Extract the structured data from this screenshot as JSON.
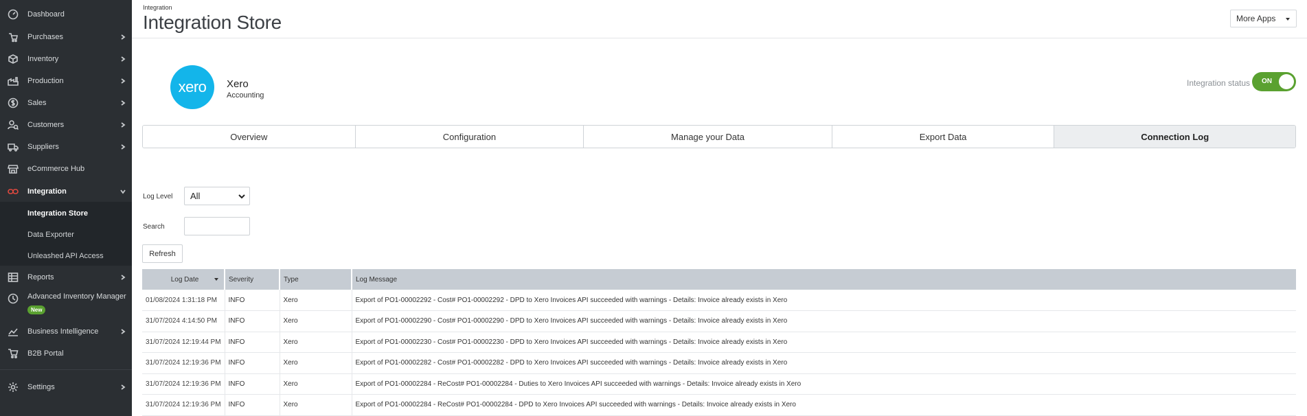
{
  "sidebar": {
    "items": [
      {
        "label": "Dashboard",
        "icon": "dashboard-icon",
        "has_children": false
      },
      {
        "label": "Purchases",
        "icon": "purchases-icon",
        "has_children": true
      },
      {
        "label": "Inventory",
        "icon": "inventory-icon",
        "has_children": true
      },
      {
        "label": "Production",
        "icon": "production-icon",
        "has_children": true
      },
      {
        "label": "Sales",
        "icon": "sales-icon",
        "has_children": true
      },
      {
        "label": "Customers",
        "icon": "customers-icon",
        "has_children": true
      },
      {
        "label": "Suppliers",
        "icon": "suppliers-icon",
        "has_children": true
      },
      {
        "label": "eCommerce Hub",
        "icon": "ecommerce-icon",
        "has_children": false
      },
      {
        "label": "Integration",
        "icon": "integration-icon",
        "has_children": true,
        "expanded": true
      },
      {
        "label": "Reports",
        "icon": "reports-icon",
        "has_children": true
      },
      {
        "label": "Advanced Inventory Manager",
        "icon": "advanced-inventory-icon",
        "has_children": false,
        "badge": "New"
      },
      {
        "label": "Business Intelligence",
        "icon": "business-intelligence-icon",
        "has_children": true
      },
      {
        "label": "B2B Portal",
        "icon": "b2b-portal-icon",
        "has_children": false
      },
      {
        "label": "Settings",
        "icon": "settings-icon",
        "has_children": true
      }
    ],
    "integration_submenu": [
      "Integration Store",
      "Data Exporter",
      "Unleashed API Access"
    ],
    "badge_new": "New"
  },
  "header": {
    "breadcrumb": "Integration",
    "title": "Integration Store",
    "more_apps": "More Apps"
  },
  "app": {
    "logo_text": "xero",
    "name": "Xero",
    "category": "Accounting",
    "status_label": "Integration status",
    "status_value": "ON"
  },
  "tabs": [
    "Overview",
    "Configuration",
    "Manage your Data",
    "Export Data",
    "Connection Log"
  ],
  "filters": {
    "log_level_label": "Log Level",
    "log_level_value": "All",
    "search_label": "Search",
    "search_value": "",
    "refresh_label": "Refresh"
  },
  "table": {
    "columns": [
      "Log Date",
      "Severity",
      "Type",
      "Log Message"
    ],
    "rows": [
      [
        "01/08/2024 1:31:18 PM",
        "INFO",
        "Xero",
        "Export of PO1-00002292 - Cost# PO1-00002292 - DPD to Xero Invoices API succeeded with warnings - Details: Invoice already exists in Xero"
      ],
      [
        "31/07/2024 4:14:50 PM",
        "INFO",
        "Xero",
        "Export of PO1-00002290 - Cost# PO1-00002290 - DPD to Xero Invoices API succeeded with warnings - Details: Invoice already exists in Xero"
      ],
      [
        "31/07/2024 12:19:44 PM",
        "INFO",
        "Xero",
        "Export of PO1-00002230 - Cost# PO1-00002230 - DPD to Xero Invoices API succeeded with warnings - Details: Invoice already exists in Xero"
      ],
      [
        "31/07/2024 12:19:36 PM",
        "INFO",
        "Xero",
        "Export of PO1-00002282 - Cost# PO1-00002282 - DPD to Xero Invoices API succeeded with warnings - Details: Invoice already exists in Xero"
      ],
      [
        "31/07/2024 12:19:36 PM",
        "INFO",
        "Xero",
        "Export of PO1-00002284 - ReCost# PO1-00002284 - Duties to Xero Invoices API succeeded with warnings - Details: Invoice already exists in Xero"
      ],
      [
        "31/07/2024 12:19:36 PM",
        "INFO",
        "Xero",
        "Export of PO1-00002284 - ReCost# PO1-00002284 - DPD to Xero Invoices API succeeded with warnings - Details: Invoice already exists in Xero"
      ]
    ]
  },
  "colors": {
    "sidebar_bg": "#2b2f33",
    "accent_red": "#e0493f",
    "toggle_green": "#5aa130",
    "xero_blue": "#13b5ea",
    "table_header": "#c6ccd3"
  }
}
